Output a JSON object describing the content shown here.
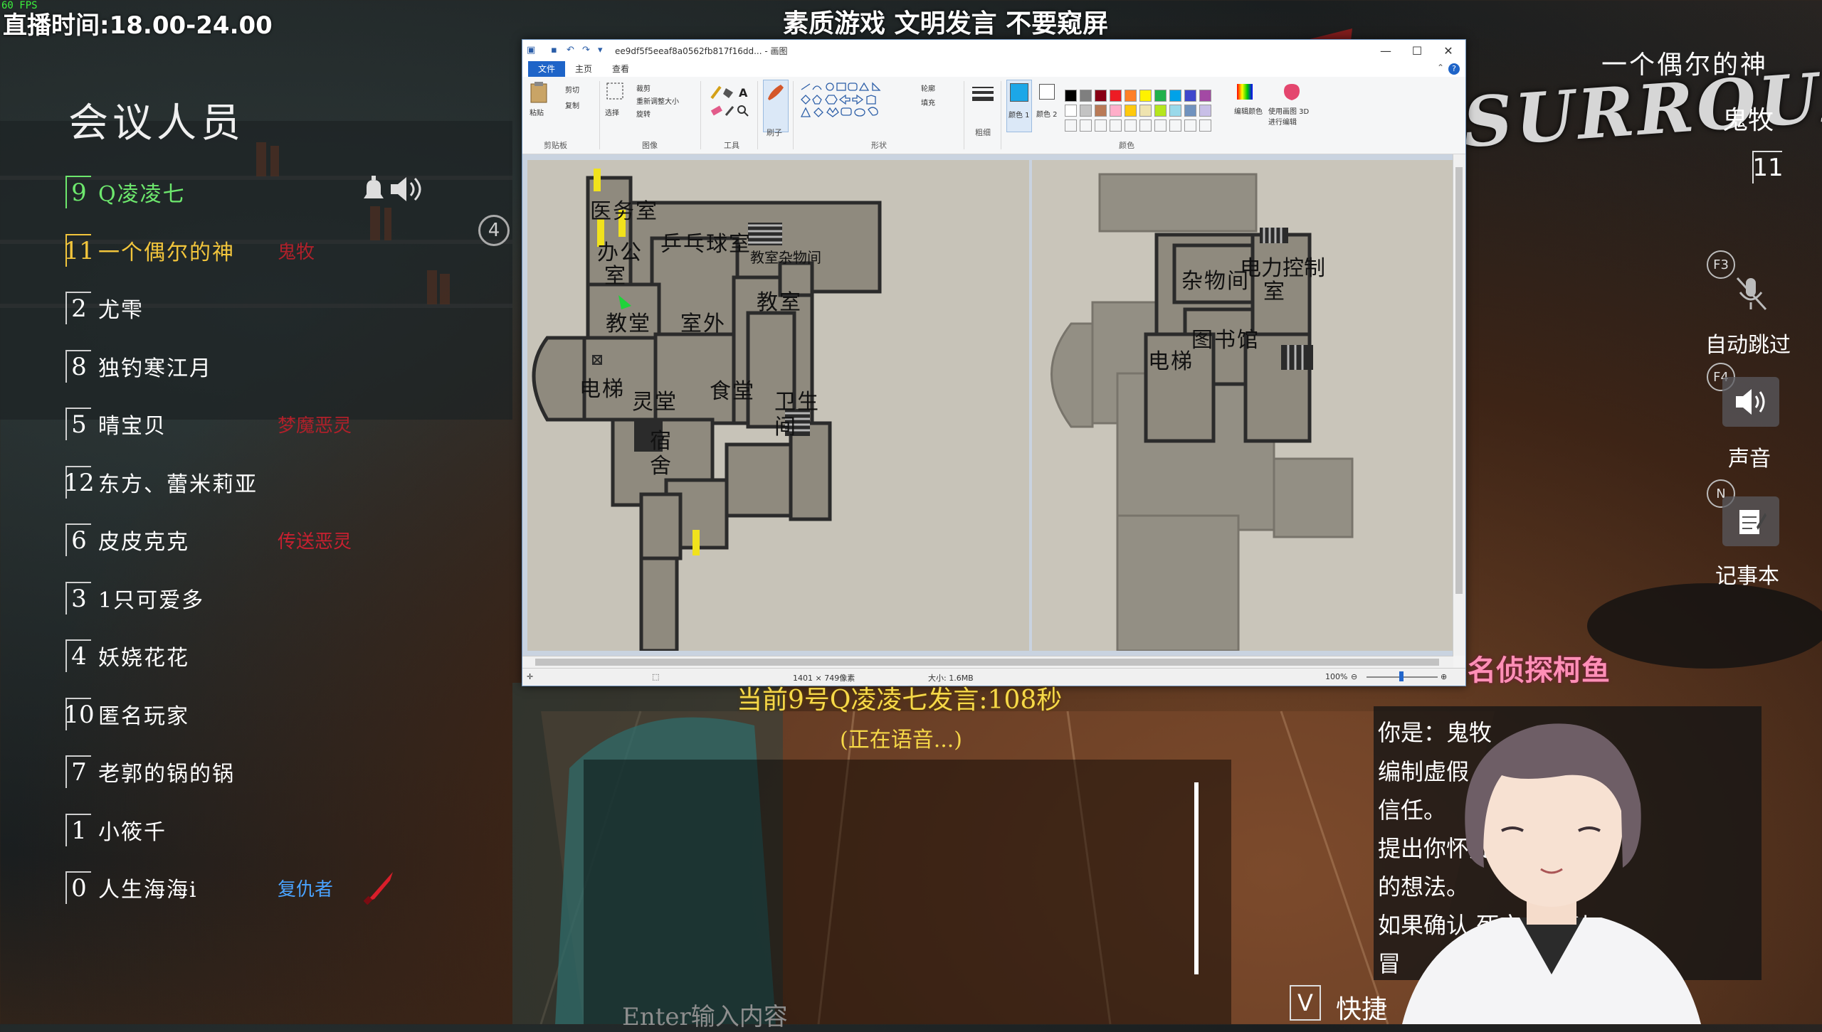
{
  "overlay": {
    "fps": "60 FPS",
    "live_time": "直播时间:18.00-24.00",
    "banner": "素质游戏 文明发言 不要窥屏",
    "game_logo_text": "SURROUNDS"
  },
  "members": {
    "title": "会议人员",
    "players": [
      {
        "number": "9",
        "name": "Q凌凌七",
        "name_color": "#6de86d",
        "tag": "",
        "tag_color": ""
      },
      {
        "number": "11",
        "name": "一个偶尔的神",
        "name_color": "#f2c53c",
        "tag": "鬼牧",
        "tag_color": "#b0202a"
      },
      {
        "number": "2",
        "name": "尤雫",
        "name_color": "#ffffff",
        "tag": "",
        "tag_color": ""
      },
      {
        "number": "8",
        "name": "独钓寒江月",
        "name_color": "#ffffff",
        "tag": "",
        "tag_color": ""
      },
      {
        "number": "5",
        "name": "晴宝贝",
        "name_color": "#ffffff",
        "tag": "梦魔恶灵",
        "tag_color": "#b0202a"
      },
      {
        "number": "12",
        "name": "东方、蕾米莉亚",
        "name_color": "#ffffff",
        "tag": "",
        "tag_color": ""
      },
      {
        "number": "6",
        "name": "皮皮克克",
        "name_color": "#ffffff",
        "tag": "传送恶灵",
        "tag_color": "#c82030"
      },
      {
        "number": "3",
        "name": "1只可爱多",
        "name_color": "#ffffff",
        "tag": "",
        "tag_color": ""
      },
      {
        "number": "4",
        "name": "妖娆花花",
        "name_color": "#ffffff",
        "tag": "",
        "tag_color": ""
      },
      {
        "number": "10",
        "name": "匿名玩家",
        "name_color": "#ffffff",
        "tag": "",
        "tag_color": ""
      },
      {
        "number": "7",
        "name": "老郭的锅的锅",
        "name_color": "#ffffff",
        "tag": "",
        "tag_color": ""
      },
      {
        "number": "1",
        "name": "小筱千",
        "name_color": "#ffffff",
        "tag": "",
        "tag_color": ""
      },
      {
        "number": "0",
        "name": "人生海海i",
        "name_color": "#ffffff",
        "tag": "复仇者",
        "tag_color": "#4aa3ff"
      }
    ],
    "bubble_number": "4"
  },
  "paint": {
    "title": "ee9df5f5eeaf8a0562fb817f16dd... - 画图",
    "tabs": [
      "文件",
      "主页",
      "查看"
    ],
    "ribbon": {
      "clipboard": {
        "paste": "粘贴",
        "cut": "剪切",
        "copy": "复制",
        "label": "剪贴板"
      },
      "image": {
        "select": "选择",
        "crop": "裁剪",
        "resize": "重新调整大小",
        "rotate": "旋转",
        "label": "图像"
      },
      "tools": {
        "label": "工具"
      },
      "brushes": {
        "label": "刷子"
      },
      "shapes": {
        "outline": "轮廓",
        "fill": "填充",
        "label": "形状"
      },
      "size": {
        "label": "粗细"
      },
      "colors": {
        "color1": "颜色 1",
        "color2": "颜色 2",
        "edit": "编辑颜色",
        "label": "颜色",
        "paint3d": "使用画图 3D 进行编辑"
      },
      "palette": [
        "#000000",
        "#7f7f7f",
        "#880015",
        "#ed1c24",
        "#ff7f27",
        "#fff200",
        "#22b14c",
        "#00a2e8",
        "#3f48cc",
        "#a349a4",
        "#ffffff",
        "#c3c3c3",
        "#b97a57",
        "#ffaec9",
        "#ffc90e",
        "#efe4b0",
        "#b5e61d",
        "#99d9ea",
        "#7092be",
        "#c8bfe7"
      ]
    },
    "status": {
      "dimensions": "1401 × 749像素",
      "size": "大小: 1.6MB",
      "zoom": "100%"
    },
    "map_left_labels": [
      "医务室",
      "办公",
      "室",
      "乒乓球室",
      "教室杂物间",
      "教堂",
      "室外",
      "教室",
      "电梯",
      "灵堂",
      "食堂",
      "卫生",
      "间",
      "宿",
      "舍"
    ],
    "map_right_labels": [
      "杂物间",
      "电力控制",
      "室",
      "图书馆",
      "电梯"
    ]
  },
  "speech": {
    "speaking_now": "当前9号Q凌凌七发言:108秒",
    "voice_status": "(正在语音...)",
    "input_placeholder": "Enter输入内容",
    "shortcut_key": "V",
    "shortcut_label": "快捷"
  },
  "right_panel": {
    "self_name": "一个偶尔的神",
    "self_role": "鬼牧",
    "self_number": "11",
    "controls": [
      {
        "key": "F3",
        "label": "自动跳过",
        "icon": "mic-muted-icon"
      },
      {
        "key": "F4",
        "label": "声音",
        "icon": "speaker-icon"
      },
      {
        "key": "N",
        "label": "记事本",
        "icon": "notepad-icon"
      }
    ],
    "detective_name": "名侦探柯鱼",
    "role_text": [
      "你是：鬼牧",
      "编制虚假                  人们的",
      "信任。",
      "提出你怀疑              并说出你",
      "的想法。",
      "如果确认                死亡，可以",
      "冒"
    ]
  },
  "colors": {
    "accent_green": "#6de86d",
    "accent_yellow": "#f6d848",
    "detective_pink": "#ff8fb6"
  }
}
